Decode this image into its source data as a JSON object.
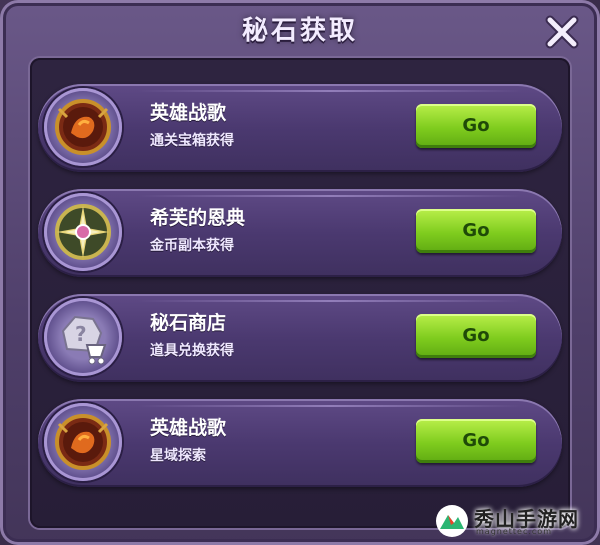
{
  "header": {
    "title": "秘石获取",
    "close_icon": "close-x-icon"
  },
  "sources": [
    {
      "title": "英雄战歌",
      "subtitle": "通关宝箱获得",
      "icon": "hero-anthem-emblem-icon",
      "button": "Go"
    },
    {
      "title": "希芙的恩典",
      "subtitle": "金币副本获得",
      "icon": "compass-star-emblem-icon",
      "button": "Go"
    },
    {
      "title": "秘石商店",
      "subtitle": "道具兑换获得",
      "icon": "mystery-stone-cart-icon",
      "button": "Go"
    },
    {
      "title": "英雄战歌",
      "subtitle": "星域探索",
      "icon": "hero-anthem-emblem-icon",
      "button": "Go"
    }
  ],
  "watermark": {
    "name": "秀山手游网",
    "url": "magnettec.com"
  },
  "colors": {
    "go_button": "#7fcc1e",
    "panel": "#2e2440",
    "row": "#4b3970"
  }
}
